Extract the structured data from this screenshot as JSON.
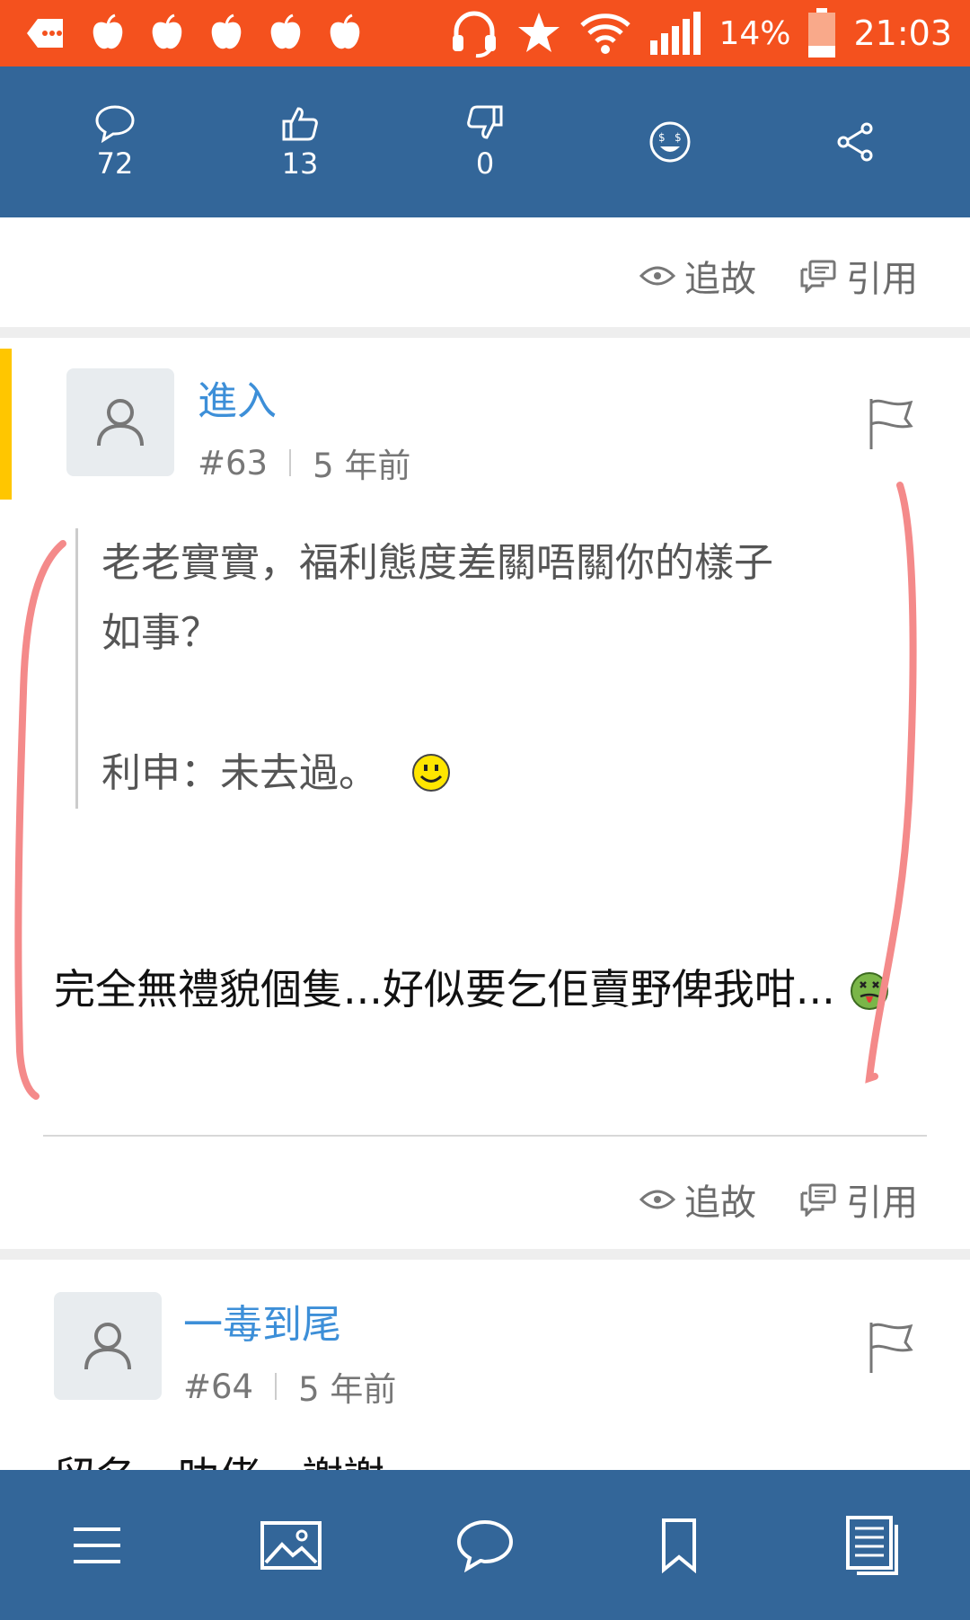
{
  "status_bar": {
    "battery_pct": "14%",
    "time": "21:03"
  },
  "top_bar": {
    "comments_count": "72",
    "likes_count": "13",
    "dislikes_count": "0"
  },
  "actions": {
    "follow_label": "追故",
    "quote_label": "引用"
  },
  "posts": [
    {
      "username": "進入",
      "number": "#63",
      "time_ago": "5 年前",
      "quote_lines": [
        "老老實實，福利態度差關唔關你的樣子",
        "如事？",
        "",
        "利申：未去過。"
      ],
      "body": "完全無禮貌個隻...好似要乞佢賣野俾我咁..."
    },
    {
      "username": "一毒到尾",
      "number": "#64",
      "time_ago": "5 年前",
      "body_preview": "留名，叻佬，謝謝"
    }
  ],
  "colors": {
    "status_bar": "#f4511e",
    "nav_bar": "#336699",
    "link": "#3d8fd8",
    "accent": "#ffc600",
    "annotation": "#f48a8a"
  }
}
